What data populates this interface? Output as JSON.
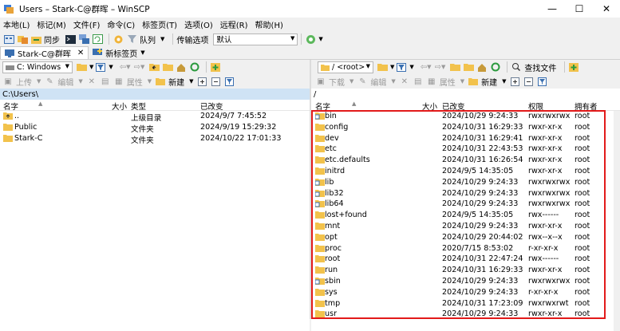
{
  "window": {
    "title": "Users – Stark-C@群晖 – WinSCP",
    "controls": [
      "—",
      "☐",
      "✕"
    ]
  },
  "menu": [
    "本地(L)",
    "标记(M)",
    "文件(F)",
    "命令(C)",
    "标签页(T)",
    "选项(O)",
    "远程(R)",
    "帮助(H)"
  ],
  "toolbar": {
    "sync_label": "同步",
    "queue_label": "队列",
    "transfer_options_label": "传输选项",
    "transfer_preset": "默认"
  },
  "tabs": {
    "session": "Stark-C@群晖",
    "new_tab": "新标签页"
  },
  "left": {
    "drive": "C: Windows",
    "upload_label": "上传",
    "edit_label": "编辑",
    "properties_label": "属性",
    "new_label": "新建",
    "path": "C:\\Users\\",
    "columns": [
      "名字",
      "大小",
      "类型",
      "已改变"
    ],
    "files": [
      {
        "name": "..",
        "type": "上级目录",
        "modified": "2024/9/7  7:45:52",
        "icon": "parent-dir"
      },
      {
        "name": "Public",
        "type": "文件夹",
        "modified": "2024/9/19  15:29:32",
        "icon": "folder"
      },
      {
        "name": "Stark-C",
        "type": "文件夹",
        "modified": "2024/10/22  17:01:33",
        "icon": "folder"
      }
    ]
  },
  "right": {
    "folder": "/ <root>",
    "find_label": "查找文件",
    "download_label": "下载",
    "edit_label": "编辑",
    "properties_label": "属性",
    "new_label": "新建",
    "path": "/",
    "columns": [
      "名字",
      "大小",
      "已改变",
      "权限",
      "拥有者"
    ],
    "files": [
      {
        "name": "bin",
        "modified": "2024/10/29  9:24:33",
        "perm": "rwxrwxrwx",
        "owner": "root",
        "link": true
      },
      {
        "name": "config",
        "modified": "2024/10/31  16:29:33",
        "perm": "rwxr-xr-x",
        "owner": "root",
        "link": false
      },
      {
        "name": "dev",
        "modified": "2024/10/31  16:29:41",
        "perm": "rwxr-xr-x",
        "owner": "root",
        "link": false
      },
      {
        "name": "etc",
        "modified": "2024/10/31  22:43:53",
        "perm": "rwxr-xr-x",
        "owner": "root",
        "link": false
      },
      {
        "name": "etc.defaults",
        "modified": "2024/10/31  16:26:54",
        "perm": "rwxr-xr-x",
        "owner": "root",
        "link": false
      },
      {
        "name": "initrd",
        "modified": "2024/9/5  14:35:05",
        "perm": "rwxr-xr-x",
        "owner": "root",
        "link": false
      },
      {
        "name": "lib",
        "modified": "2024/10/29  9:24:33",
        "perm": "rwxrwxrwx",
        "owner": "root",
        "link": true
      },
      {
        "name": "lib32",
        "modified": "2024/10/29  9:24:33",
        "perm": "rwxrwxrwx",
        "owner": "root",
        "link": true
      },
      {
        "name": "lib64",
        "modified": "2024/10/29  9:24:33",
        "perm": "rwxrwxrwx",
        "owner": "root",
        "link": true
      },
      {
        "name": "lost+found",
        "modified": "2024/9/5  14:35:05",
        "perm": "rwx------",
        "owner": "root",
        "link": false
      },
      {
        "name": "mnt",
        "modified": "2024/10/29  9:24:33",
        "perm": "rwxr-xr-x",
        "owner": "root",
        "link": false
      },
      {
        "name": "opt",
        "modified": "2024/10/29  20:44:02",
        "perm": "rwx--x--x",
        "owner": "root",
        "link": false
      },
      {
        "name": "proc",
        "modified": "2020/7/15  8:53:02",
        "perm": "r-xr-xr-x",
        "owner": "root",
        "link": false
      },
      {
        "name": "root",
        "modified": "2024/10/31  22:47:24",
        "perm": "rwx------",
        "owner": "root",
        "link": false
      },
      {
        "name": "run",
        "modified": "2024/10/31  16:29:33",
        "perm": "rwxr-xr-x",
        "owner": "root",
        "link": false
      },
      {
        "name": "sbin",
        "modified": "2024/10/29  9:24:33",
        "perm": "rwxrwxrwx",
        "owner": "root",
        "link": true
      },
      {
        "name": "sys",
        "modified": "2024/10/29  9:24:33",
        "perm": "r-xr-xr-x",
        "owner": "root",
        "link": false
      },
      {
        "name": "tmp",
        "modified": "2024/10/31  17:23:09",
        "perm": "rwxrwxrwt",
        "owner": "root",
        "link": false
      },
      {
        "name": "usr",
        "modified": "2024/10/29  9:24:33",
        "perm": "rwxr-xr-x",
        "owner": "root",
        "link": false
      }
    ]
  },
  "colors": {
    "folder": "#f2c24c",
    "path_bg": "#cfe3f5",
    "highlight": "#e21a1a"
  }
}
